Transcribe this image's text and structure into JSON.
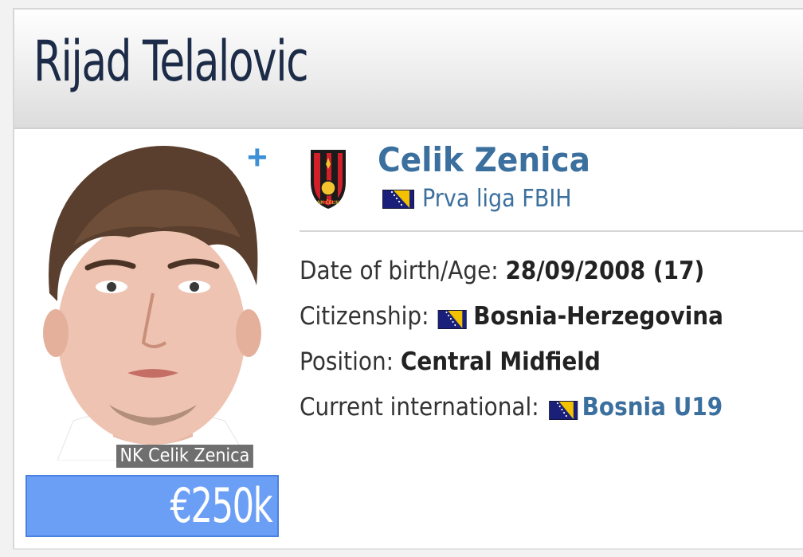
{
  "player": {
    "name": "Rijad Telalovic",
    "photo_caption": "NK Celik Zenica",
    "market_value": "€250k"
  },
  "club": {
    "name": "Celik Zenica",
    "league": "Prva liga FBIH",
    "league_flag": "bosnia-flag"
  },
  "details": {
    "dob_label": "Date of birth/Age:",
    "dob_value": "28/09/2008 (17)",
    "citizenship_label": "Citizenship:",
    "citizenship_value": "Bosnia-Herzegovina",
    "position_label": "Position:",
    "position_value": "Central Midfield",
    "international_label": "Current international:",
    "international_value": "Bosnia U19"
  },
  "colors": {
    "title": "#1c2b47",
    "link": "#3a6f9e",
    "market_value_bg": "#6b9ff6",
    "plus": "#3d8fd6"
  },
  "icons": {
    "add": "plus-icon",
    "club_crest": "club-crest-icon",
    "flag": "bosnia-flag-icon"
  }
}
